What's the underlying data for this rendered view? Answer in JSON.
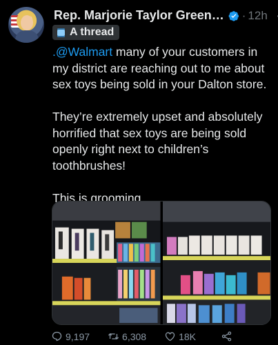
{
  "tweet": {
    "author_name": "Rep. Marjorie Taylor Green…",
    "time": "12h",
    "dot": "·",
    "more": "···",
    "thread_label": "A thread",
    "mention": ".@Walmart",
    "para1_rest": " many of your customers in my district are reaching out to me about sex toys being sold in your Dalton store.",
    "para2": "They’re extremely upset and absolutely horrified that sex toys are being sold openly right next to children’s toothbrushes!",
    "para3": "This is grooming."
  },
  "actions": {
    "replies": "9,197",
    "retweets": "6,308",
    "likes": "18K"
  },
  "colors": {
    "background": "#000000",
    "text": "#e7e9ea",
    "muted": "#71767b",
    "link": "#1d9bf0",
    "verified": "#1d9bf0"
  },
  "icons": {
    "verified": "verified-badge-icon",
    "thread": "thread-spool-icon",
    "reply": "reply-icon",
    "retweet": "retweet-icon",
    "like": "heart-icon",
    "share": "share-icon"
  }
}
